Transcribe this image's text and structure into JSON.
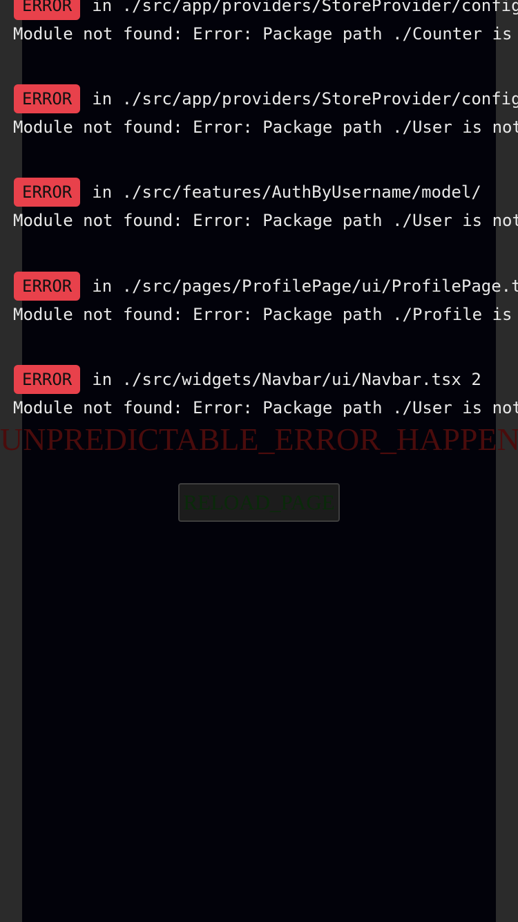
{
  "errors": [
    {
      "badge": "ERROR",
      "location": "in ./src/app/providers/StoreProvider/config/store.ts",
      "message": "Module not found: Error: Package path ./Counter is not exported"
    },
    {
      "badge": "ERROR",
      "location": "in ./src/app/providers/StoreProvider/config/store.ts",
      "message": "Module not found: Error: Package path ./User is not exported"
    },
    {
      "badge": "ERROR",
      "location": "in ./src/features/AuthByUsername/model/",
      "message": "Module not found: Error: Package path ./User is not exported"
    },
    {
      "badge": "ERROR",
      "location": "in ./src/pages/ProfilePage/ui/ProfilePage.tsx",
      "message": "Module not found: Error: Package path ./Profile is not exported"
    },
    {
      "badge": "ERROR",
      "location": "in ./src/widgets/Navbar/ui/Navbar.tsx 2",
      "message": "Module not found: Error: Package path ./User is not exported"
    }
  ],
  "fallback": {
    "title": "UNPREDICTABLE_ERROR_HAPPENED",
    "reload_label": "RELOAD_PAGE"
  }
}
